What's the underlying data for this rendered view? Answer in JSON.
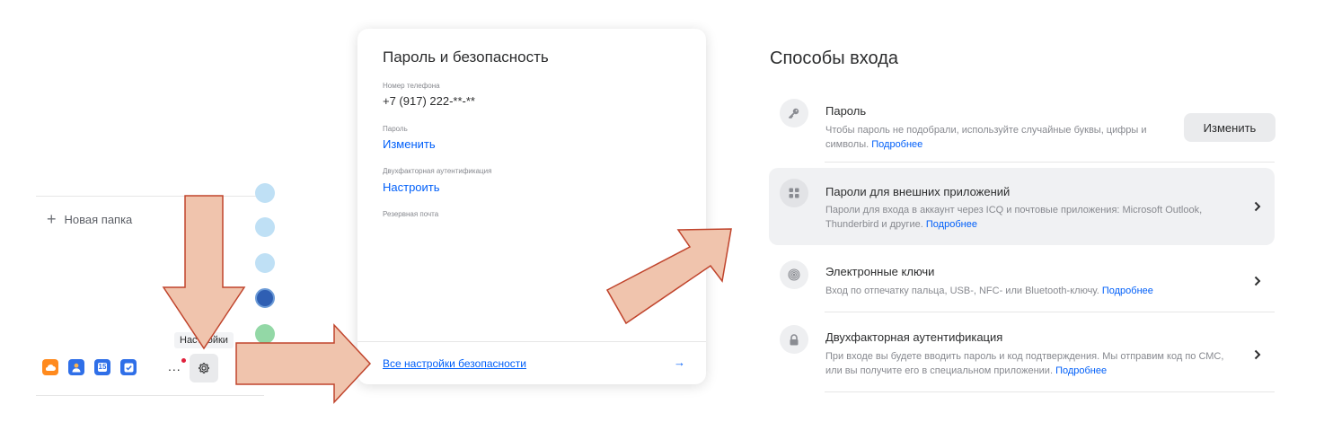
{
  "left_panel": {
    "new_folder_label": "Новая папка",
    "settings_tooltip": "Настройки",
    "more_label": "...",
    "calendar_day": "15"
  },
  "security_card": {
    "title": "Пароль и безопасность",
    "phone_label": "Номер телефона",
    "phone_value": "+7 (917) 222-**-**",
    "password_label": "Пароль",
    "password_action": "Изменить",
    "twofa_label": "Двухфакторная аутентификация",
    "twofa_action": "Настроить",
    "backup_email_label": "Резервная почта",
    "all_settings_link": "Все настройки безопасности",
    "arrow": "→"
  },
  "login_methods": {
    "title": "Способы входа",
    "items": [
      {
        "title": "Пароль",
        "desc": "Чтобы пароль не подобрали, используйте случайные буквы, цифры и символы.",
        "more": "Подробнее",
        "action": "Изменить",
        "icon": "key-icon"
      },
      {
        "title": "Пароли для внешних приложений",
        "desc": "Пароли для входа в аккаунт через ICQ и почтовые приложения: Microsoft Outlook, Thunderbird и другие.",
        "more": "Подробнее",
        "icon": "apps-grid-icon"
      },
      {
        "title": "Электронные ключи",
        "desc": "Вход по отпечатку пальца, USB-, NFC- или Bluetooth-ключу.",
        "more": "Подробнее",
        "icon": "fingerprint-icon"
      },
      {
        "title": "Двухфакторная аутентификация",
        "desc": "При входе вы будете вводить пароль и код подтверждения. Мы отправим код по СМС, или вы получите его в специальном приложении.",
        "more": "Подробнее",
        "icon": "lock-icon"
      }
    ]
  },
  "colors": {
    "link": "#005ff9",
    "annotation_arrow_fill": "#f0c4ad",
    "annotation_arrow_stroke": "#c0442c"
  }
}
